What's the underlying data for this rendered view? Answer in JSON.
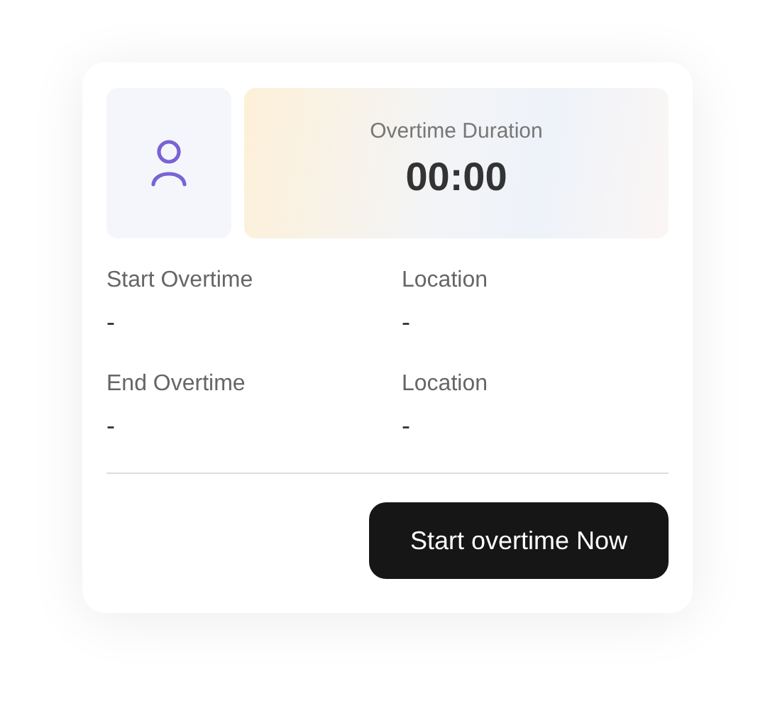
{
  "duration": {
    "label": "Overtime Duration",
    "value": "00:00"
  },
  "fields": [
    {
      "label": "Start Overtime",
      "value": "-"
    },
    {
      "label": "Location",
      "value": "-"
    },
    {
      "label": "End Overtime",
      "value": "-"
    },
    {
      "label": "Location",
      "value": "-"
    }
  ],
  "button": {
    "label": "Start overtime Now"
  }
}
